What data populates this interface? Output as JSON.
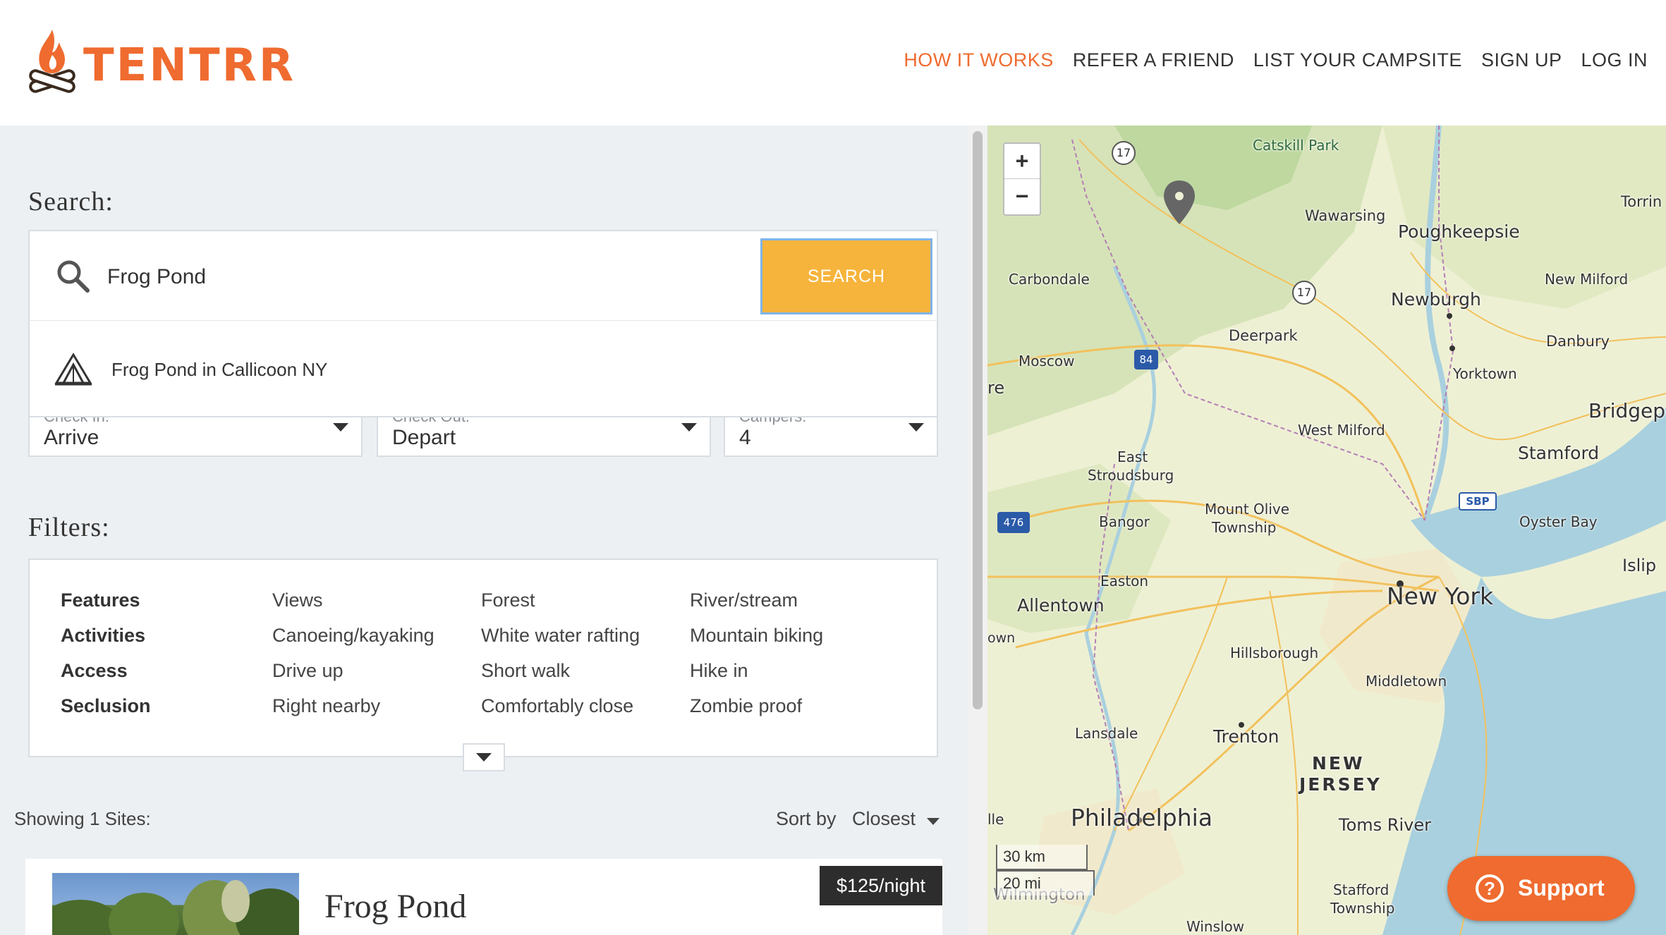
{
  "brand": {
    "name": "TENTRR",
    "color": "#ef6b2f"
  },
  "nav": [
    {
      "label": "HOW IT WORKS",
      "active": true
    },
    {
      "label": "REFER A FRIEND"
    },
    {
      "label": "LIST YOUR CAMPSITE"
    },
    {
      "label": "SIGN UP"
    },
    {
      "label": "LOG IN"
    }
  ],
  "search": {
    "title": "Search:",
    "value": "Frog Pond",
    "button": "SEARCH",
    "suggestion": "Frog Pond in Callicoon NY"
  },
  "dates": {
    "check_in": {
      "label": "Check In:",
      "value": "Arrive"
    },
    "check_out": {
      "label": "Check Out:",
      "value": "Depart"
    },
    "campers": {
      "label": "Campers:",
      "value": "4"
    }
  },
  "filters": {
    "title": "Filters:",
    "rows": [
      {
        "head": "Features",
        "options": [
          "Views",
          "Forest",
          "River/stream"
        ]
      },
      {
        "head": "Activities",
        "options": [
          "Canoeing/kayaking",
          "White water rafting",
          "Mountain biking"
        ]
      },
      {
        "head": "Access",
        "options": [
          "Drive up",
          "Short walk",
          "Hike in"
        ]
      },
      {
        "head": "Seclusion",
        "options": [
          "Right nearby",
          "Comfortably close",
          "Zombie proof"
        ]
      }
    ]
  },
  "results": {
    "showing": "Showing 1 Sites:",
    "sort_label": "Sort by",
    "sort_value": "Closest",
    "items": [
      {
        "name": "Frog Pond",
        "price": "$125/night"
      }
    ]
  },
  "map": {
    "labels": {
      "catskill": "Catskill Park",
      "wawarsing": "Wawarsing",
      "poughkeepsie": "Poughkeepsie",
      "torrington": "Torrin",
      "carbondale": "Carbondale",
      "newmilford": "New Milford",
      "newburgh": "Newburgh",
      "danbury": "Danbury",
      "deerpark": "Deerpark",
      "moscow": "Moscow",
      "yorktown": "Yorktown",
      "re": "re",
      "bridgeport": "Bridgepo",
      "westmilford": "West Milford",
      "stamford": "Stamford",
      "east": "East",
      "stroudsburg": "Stroudsburg",
      "mountolive1": "Mount Olive",
      "mountolive2": "Township",
      "sbp": "SBP",
      "oysterbay": "Oyster Bay",
      "bangor": "Bangor",
      "islip": "Islip",
      "easton": "Easton",
      "newyork": "New York",
      "allentown": "Allentown",
      "own": "own",
      "hillsborough": "Hillsborough",
      "middletown": "Middletown",
      "lansdale": "Lansdale",
      "trenton": "Trenton",
      "newjersey1": "NEW",
      "newjersey2": "JERSEY",
      "lle": "lle",
      "philadelphia": "Philadelphia",
      "tomsriver": "Toms River",
      "stafford1": "Stafford",
      "stafford2": "Township",
      "wilmington": "Wilmington",
      "winslow": "Winslow",
      "r17a": "17",
      "r17b": "17",
      "r84": "84",
      "r476": "476"
    },
    "zoom_in": "+",
    "zoom_out": "−",
    "scale_km": "30 km",
    "scale_mi": "20 mi",
    "water_color": "#a9d0de",
    "land_color": "#eef0d4"
  },
  "support": {
    "label": "Support"
  }
}
